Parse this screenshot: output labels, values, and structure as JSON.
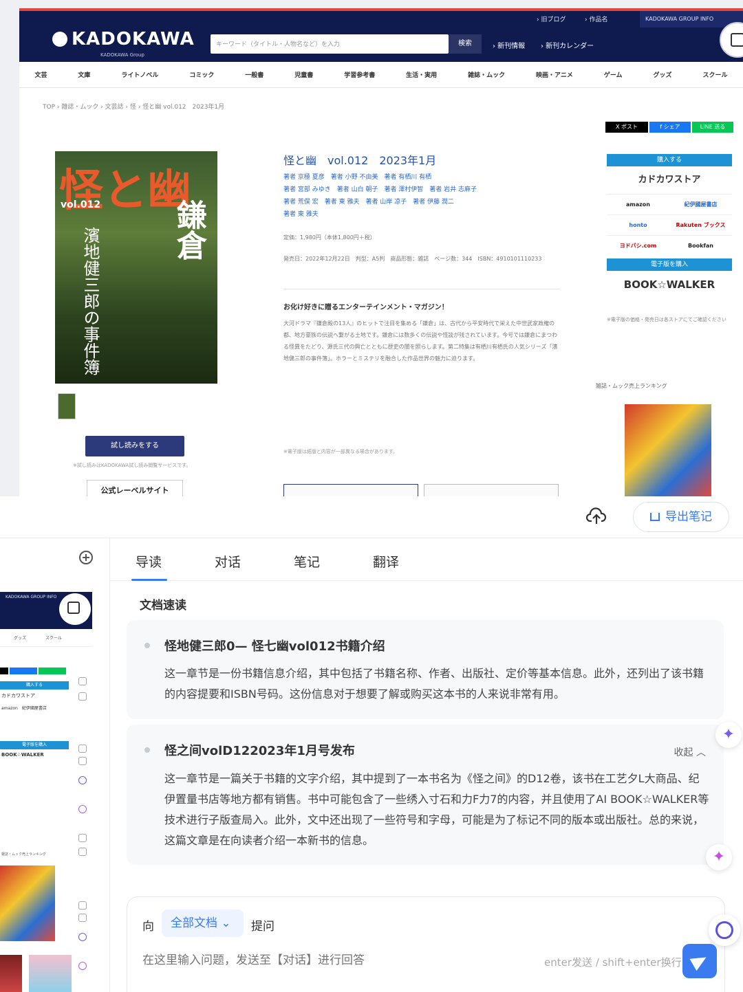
{
  "kadokawa": {
    "logo": "KADOKAWA",
    "logo_sub": "KADOKAWA Group",
    "search_placeholder": "キーワード（タイトル・人物名など）を入力",
    "search_button": "検索",
    "top_links": [
      "› 旧ブログ",
      "› 作品名",
      "KADOKAWA GROUP INFO"
    ],
    "head_links": [
      "› 新刊情報",
      "› 新刊カレンダー"
    ],
    "nav": [
      "文芸",
      "文庫",
      "ライトノベル",
      "コミック",
      "一般書",
      "児童書",
      "学習参考書",
      "生活・実用",
      "雑誌・ムック",
      "映画・アニメ",
      "ゲーム",
      "グッズ",
      "スクール"
    ],
    "breadcrumb": "TOP › 雑誌・ムック › 文芸誌 › 怪 › 怪と幽 vol.012　2023年1月",
    "share": [
      "X ポスト",
      "f シェア",
      "LINE 送る"
    ],
    "cover": {
      "title": "怪と幽",
      "vol": "vol.012",
      "right": "鎌倉",
      "left": "濱地健三郎の事件簿"
    },
    "trial_button": "試し読みをする",
    "trial_note": "※試し読みはKADOKAWA試し読み閲覧サービスです。",
    "official_link": "公式レーベルサイト",
    "title": "怪と幽　vol.012　2023年1月",
    "authors": [
      "著者 京極 夏彦　著者 小野 不由美　著者 有栖川 有栖",
      "著者 宮部 みゆき　著者 山白 朝子　著者 澤村伊智　著者 岩井 志麻子",
      "著者 荒俣 宏　著者 東 雅夫　著者 山岸 凉子　著者 伊藤 潤二",
      "著者 東 雅夫"
    ],
    "price": "定価：1,980円（本体1,800円＋税）",
    "release": "発売日：2022年12月22日　判型：A5判　商品形態：雑誌　ページ数：344　ISBN：4910101110233",
    "copy_heading": "お化け好きに贈るエンターテインメント・マガジン！",
    "copy": "大河ドラマ『鎌倉殿の13人』のヒットで注目を集める「鎌倉」は、古代から平安時代で栄えた中世武家政権の都、地方豪族の伝説へ繋がる土地です。鎌倉には数多くの伝説や怪談が残されています。今号では鎌倉にまつわる怪異をたどり、源氏三代の興亡とともに歴史の闇を照らします。第二特集は有栖川有栖氏の人気シリーズ「濱地健三郎の事件簿」。ホラーとミステリを融合した作品世界の魅力に迫ります。",
    "copy_note": "※電子版は紙版と内容が一部異なる場合があります。",
    "buy_heading": "購入する",
    "store_main": "カドカワストア",
    "stores": [
      "amazon",
      "紀伊國屋書店",
      "honto",
      "Rakuten ブックス",
      "ヨドバシ.com",
      "Bookfan"
    ],
    "ebook_heading": "電子版を購入",
    "ebook_store": "BOOK☆WALKER",
    "ebook_note": "※電子版の価格・発売日は各ストアにてご確認ください",
    "ranking": "雑誌・ムック売上ランキング"
  },
  "toolbar": {
    "export_label": "导出笔记"
  },
  "mini": {
    "group": "KADOKAWA GROUP INFO",
    "nav": [
      "グッズ",
      "スクール"
    ],
    "buy_heading": "購入する",
    "store_main": "カドカワストア",
    "stores": "amazon　紀伊國屋書店",
    "ebook_heading": "電子版を購入",
    "ebook_store": "BOOK☆WALKER",
    "ranking": "雑誌・ムック売上ランキング"
  },
  "tabs": [
    "导读",
    "对话",
    "笔记",
    "翻译"
  ],
  "section_title": "文档速读",
  "cards": [
    {
      "title": "怪地健三郎0— 怪七幽vol012书籍介绍",
      "body": "这一章节是一份书籍信息介绍，其中包括了书籍名称、作者、出版社、定价等基本信息。此外，还列出了该书籍的内容提要和ISBN号码。这份信息对于想要了解或购买这本书的人来说非常有用。"
    },
    {
      "title": "怪之间volD122023年1月号发布",
      "collapse": "收起 ︿",
      "body": "这一章节是一篇关于书籍的文字介绍，其中提到了一本书名为《怪之间》的D12卷，该书在工艺夕L大商品、纪伊置量书店等地方都有销售。书中可能包含了一些绣入寸石和力F力7的内容，并且使用了AI BOOK☆WALKER等技术进行子版查局入。此外，文中还出现了一些符号和字母，可能是为了标记不同的版本或出版社。总的来说，这篇文章是在向读者介绍一本新书的信息。"
    }
  ],
  "ask": {
    "to": "向",
    "scope": "全部文档 ⌄",
    "label": "提问",
    "placeholder": "在这里输入问题，发送至【对话】进行回答",
    "hint": "enter发送 / shift+enter换行"
  },
  "colors": {
    "accent": "#3a7cf0",
    "kadokawa_navy": "#0f1b4f",
    "buy_blue": "#1d93d6"
  }
}
